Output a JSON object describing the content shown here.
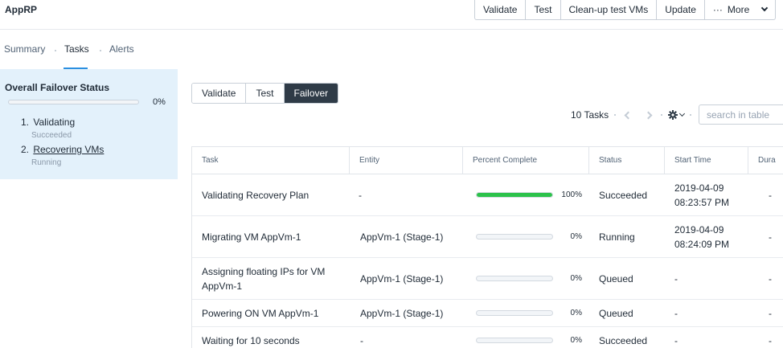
{
  "app": {
    "title": "AppRP"
  },
  "actions": {
    "validate": "Validate",
    "test": "Test",
    "cleanup": "Clean-up test VMs",
    "update": "Update",
    "more_dots": "···",
    "more": "More"
  },
  "tabs": [
    {
      "label": "Summary",
      "active": false
    },
    {
      "label": "Tasks",
      "active": true
    },
    {
      "label": "Alerts",
      "active": false
    }
  ],
  "failover_status": {
    "title": "Overall Failover Status",
    "progress_percent": 0,
    "progress_label": "0%",
    "steps": [
      {
        "num": "1.",
        "label": "Validating",
        "status": "Succeeded"
      },
      {
        "num": "2.",
        "label": "Recovering VMs",
        "status": "Running"
      }
    ]
  },
  "mode_buttons": [
    {
      "label": "Validate",
      "active": false
    },
    {
      "label": "Test",
      "active": false
    },
    {
      "label": "Failover",
      "active": true
    }
  ],
  "toolbar": {
    "task_count": "10 Tasks",
    "search_placeholder": "search in table"
  },
  "table": {
    "columns": [
      "Task",
      "Entity",
      "Percent Complete",
      "Status",
      "Start Time",
      "Dura"
    ],
    "rows": [
      {
        "task": "Validating Recovery Plan",
        "entity": "-",
        "percent": 100,
        "percent_label": "100%",
        "status": "Succeeded",
        "start_date": "2019-04-09",
        "start_time": "08:23:57 PM",
        "duration": "-"
      },
      {
        "task": "Migrating VM AppVm-1",
        "entity": "AppVm-1 (Stage-1)",
        "percent": 0,
        "percent_label": "0%",
        "status": "Running",
        "start_date": "2019-04-09",
        "start_time": "08:24:09 PM",
        "duration": "-"
      },
      {
        "task": "Assigning floating IPs for VM AppVm-1",
        "entity": "AppVm-1 (Stage-1)",
        "percent": 0,
        "percent_label": "0%",
        "status": "Queued",
        "start_date": "-",
        "start_time": "",
        "duration": "-"
      },
      {
        "task": "Powering ON VM AppVm-1",
        "entity": "AppVm-1 (Stage-1)",
        "percent": 0,
        "percent_label": "0%",
        "status": "Queued",
        "start_date": "-",
        "start_time": "",
        "duration": "-"
      },
      {
        "task": "Waiting for 10 seconds",
        "entity": "-",
        "percent": 0,
        "percent_label": "0%",
        "status": "Succeeded",
        "start_date": "-",
        "start_time": "",
        "duration": "-"
      }
    ]
  },
  "colors": {
    "accent": "#2b8fe0",
    "panel_bg": "#e3f1fb",
    "progress_fill": "#2cc24b",
    "active_button": "#2f3b47"
  },
  "icons": {
    "prev": "chevron-left-icon",
    "next": "chevron-right-icon",
    "settings": "gear-icon",
    "more": "chevron-down-icon"
  }
}
